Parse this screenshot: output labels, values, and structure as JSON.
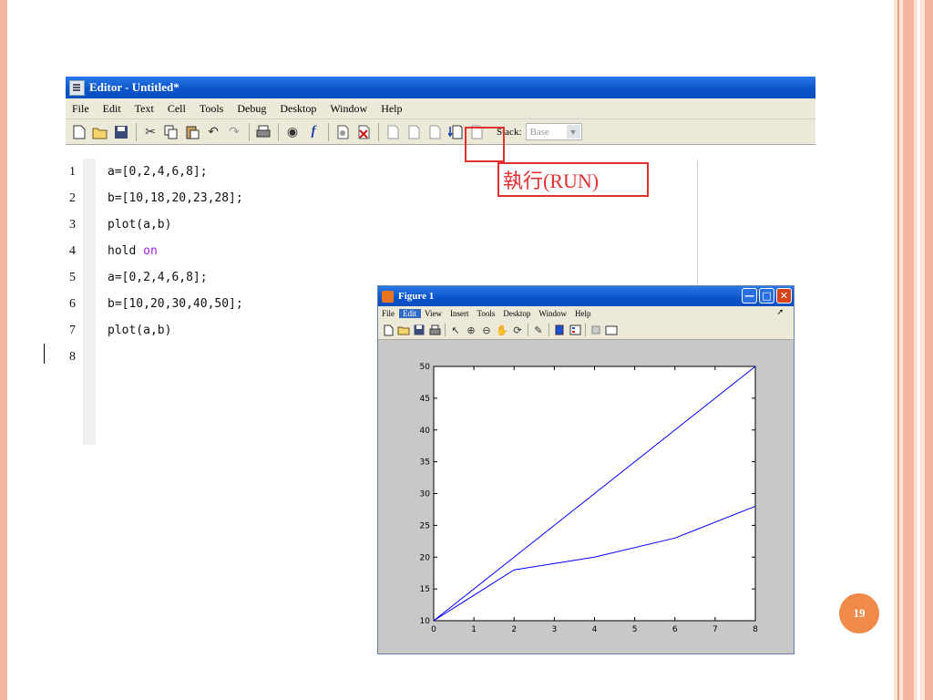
{
  "slide": {
    "page_number": "19"
  },
  "editor": {
    "title": "Editor - Untitled*",
    "menu": [
      "File",
      "Edit",
      "Text",
      "Cell",
      "Tools",
      "Debug",
      "Desktop",
      "Window",
      "Help"
    ],
    "toolbar": {
      "stack_label": "Stack:",
      "stack_value": "Base"
    },
    "lines": [
      {
        "num": "1",
        "text": "a=[0,2,4,6,8];"
      },
      {
        "num": "2",
        "text": "b=[10,18,20,23,28];"
      },
      {
        "num": "3",
        "text": "plot(a,b)"
      },
      {
        "num": "4",
        "text": "hold ",
        "kw": "on"
      },
      {
        "num": "5",
        "text": "a=[0,2,4,6,8];"
      },
      {
        "num": "6",
        "text": "b=[10,20,30,40,50];"
      },
      {
        "num": "7",
        "text": "plot(a,b)"
      },
      {
        "num": "8",
        "text": ""
      }
    ],
    "keyword_color": "#a020f0"
  },
  "annotation": {
    "run_label": "執行(RUN)",
    "color": "#e23030"
  },
  "figure": {
    "title": "Figure 1",
    "menu": [
      "File",
      "Edit",
      "View",
      "Insert",
      "Tools",
      "Desktop",
      "Window",
      "Help"
    ],
    "active_menu": "Edit"
  },
  "chart_data": {
    "type": "line",
    "x": [
      0,
      2,
      4,
      6,
      8
    ],
    "series": [
      {
        "values": [
          10,
          18,
          20,
          23,
          28
        ]
      },
      {
        "values": [
          10,
          20,
          30,
          40,
          50
        ]
      }
    ],
    "xlim": [
      0,
      8
    ],
    "ylim": [
      10,
      50
    ],
    "xticks": [
      0,
      1,
      2,
      3,
      4,
      5,
      6,
      7,
      8
    ],
    "yticks": [
      10,
      15,
      20,
      25,
      30,
      35,
      40,
      45,
      50
    ],
    "line_color": "#0000ff",
    "grid": false,
    "title": "",
    "xlabel": "",
    "ylabel": ""
  }
}
